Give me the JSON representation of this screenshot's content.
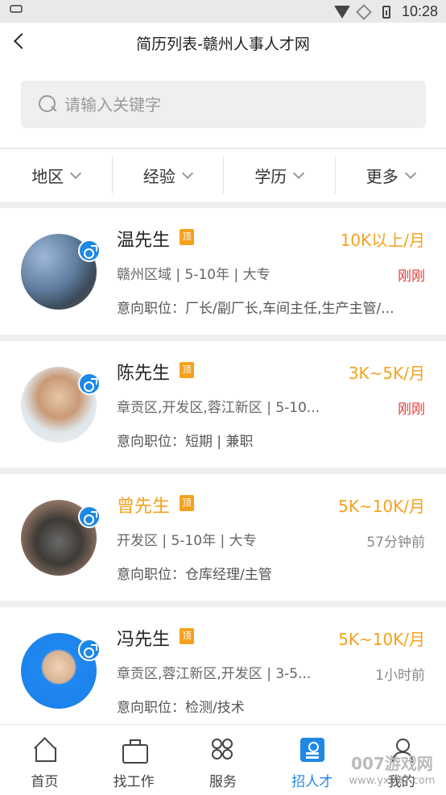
{
  "status_bar": {
    "time": "10:28"
  },
  "header": {
    "title": "简历列表-赣州人事人才网"
  },
  "search": {
    "placeholder": "请输入关键字"
  },
  "filters": [
    {
      "label": "地区"
    },
    {
      "label": "经验"
    },
    {
      "label": "学历"
    },
    {
      "label": "更多"
    }
  ],
  "resumes": [
    {
      "name": "温先生",
      "badge": "顶",
      "salary": "10K以上/月",
      "meta": "赣州区域 | 5-10年 | 大专",
      "time": "刚刚",
      "intent": "意向职位：厂长/副厂长,车间主任,生产主管/..."
    },
    {
      "name": "陈先生",
      "badge": "顶",
      "salary": "3K~5K/月",
      "meta": "章贡区,开发区,蓉江新区 | 5-10...",
      "time": "刚刚",
      "intent": "意向职位：短期 | 兼职"
    },
    {
      "name": "曾先生",
      "badge": "顶",
      "salary": "5K~10K/月",
      "meta": "开发区 | 5-10年 | 大专",
      "time": "57分钟前",
      "intent": "意向职位：仓库经理/主管"
    },
    {
      "name": "冯先生",
      "badge": "顶",
      "salary": "5K~10K/月",
      "meta": "章贡区,蓉江新区,开发区 | 3-5...",
      "time": "1小时前",
      "intent": "意向职位：检测/技术"
    }
  ],
  "tabs": [
    {
      "label": "首页",
      "icon": "home-icon"
    },
    {
      "label": "找工作",
      "icon": "briefcase-icon"
    },
    {
      "label": "服务",
      "icon": "services-icon"
    },
    {
      "label": "招人才",
      "icon": "recruit-icon"
    },
    {
      "label": "我的",
      "icon": "user-icon"
    }
  ],
  "watermark": {
    "main": "007游戏网",
    "sub": "www.yx007.com"
  },
  "colors": {
    "accent": "#1e88e5",
    "salary": "#f4a21d",
    "fresh": "#e53935"
  }
}
